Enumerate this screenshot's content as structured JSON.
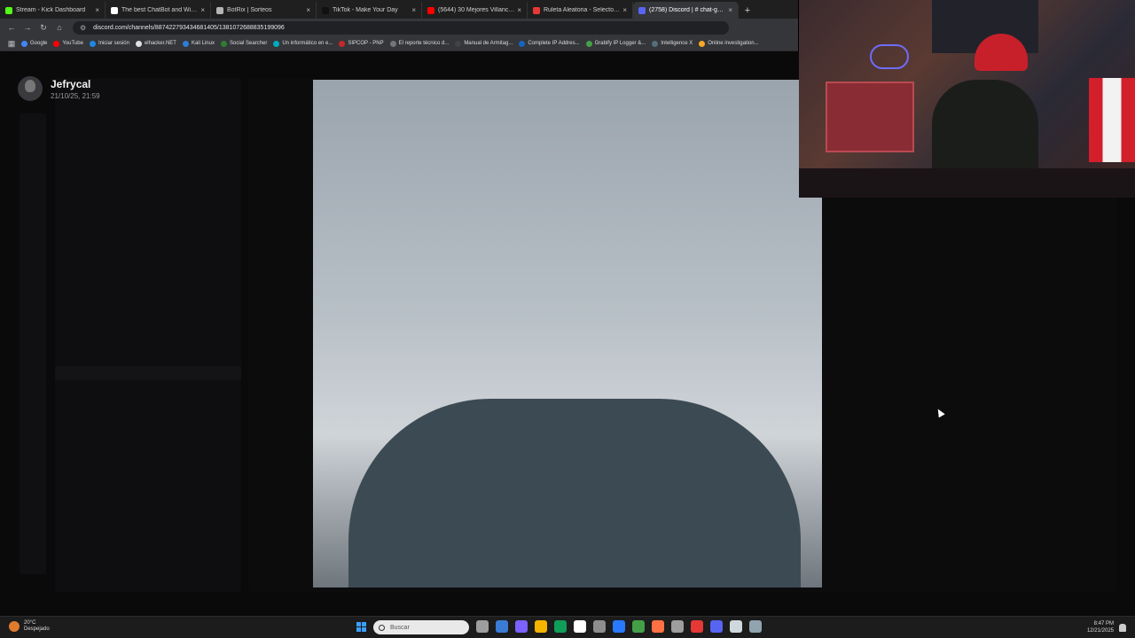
{
  "browser": {
    "tabs": [
      {
        "title": "Stream - Kick Dashboard",
        "favicon_color": "#53fc18",
        "active": false
      },
      {
        "title": "The best ChatBot and Widgets",
        "favicon_color": "#ffffff",
        "active": false
      },
      {
        "title": "BotRix | Sorteos",
        "favicon_color": "#b5b5b5",
        "active": false
      },
      {
        "title": "TikTok - Make Your Day",
        "favicon_color": "#111111",
        "active": false
      },
      {
        "title": "(5644) 30 Mejores Villancicos",
        "favicon_color": "#ff0000",
        "active": false
      },
      {
        "title": "Ruleta Aleatoria - Selector Per",
        "favicon_color": "#e53935",
        "active": false
      },
      {
        "title": "(2758) Discord | # chat-gene",
        "favicon_color": "#5865f2",
        "active": true
      }
    ],
    "new_tab_label": "+",
    "url": "discord.com/channels/887422793434681405/1381072688835199096",
    "bookmarks": [
      {
        "label": "Google",
        "color": "#4285f4"
      },
      {
        "label": "YouTube",
        "color": "#ff0000"
      },
      {
        "label": "Iniciar sesión",
        "color": "#1e88e5"
      },
      {
        "label": "elhacker.NET",
        "color": "#e0e0e0"
      },
      {
        "label": "Kali Linux",
        "color": "#2d7dd2"
      },
      {
        "label": "Social Searcher",
        "color": "#2e7d32"
      },
      {
        "label": "Un informático en e...",
        "color": "#00acc1"
      },
      {
        "label": "SIPCOP - PNP",
        "color": "#c62828"
      },
      {
        "label": "El reporte técnico d...",
        "color": "#757575"
      },
      {
        "label": "Manual de Armitag...",
        "color": "#424242"
      },
      {
        "label": "Complete IP Addres...",
        "color": "#1565c0"
      },
      {
        "label": "Grabify IP Logger &...",
        "color": "#43a047"
      },
      {
        "label": "Intelligence X",
        "color": "#546e7a"
      },
      {
        "label": "Online investigation...",
        "color": "#f9a825"
      }
    ]
  },
  "viewer": {
    "author_name": "Jefrycal",
    "author_date": "21/10/25, 21:59",
    "photo_alt": "Imagen"
  },
  "taskbar": {
    "weather_temp": "20°C",
    "weather_desc": "Despejado",
    "search_placeholder": "Buscar",
    "time": "8:47 PM",
    "date": "12/21/2025",
    "apps": [
      "#9e9e9e",
      "#3a7bd5",
      "#7b61ff",
      "#f4b400",
      "#0f9d58",
      "#ffffff",
      "#8e8e8e",
      "#2979ff",
      "#43a047",
      "#ff7043",
      "#9e9e9e",
      "#e53935",
      "#5865f2",
      "#cfd8dc",
      "#90a4ae"
    ]
  }
}
